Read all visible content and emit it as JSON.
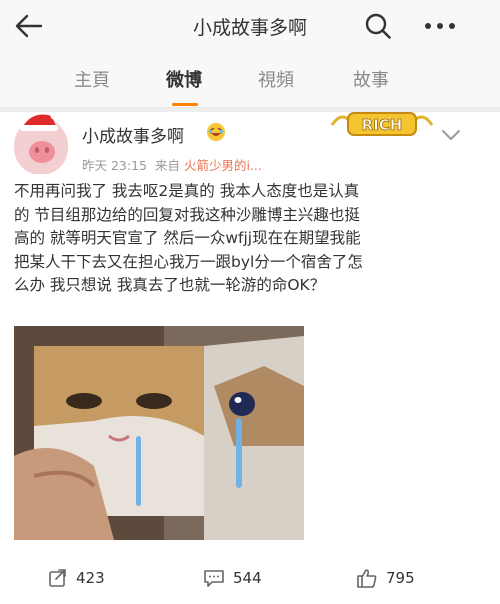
{
  "header": {
    "title": "小成故事多啊",
    "back_icon": "back-arrow-icon",
    "search_icon": "search-icon",
    "more_icon": "more-icon"
  },
  "tabs": [
    {
      "label": "主頁",
      "active": false
    },
    {
      "label": "微博",
      "active": true
    },
    {
      "label": "視頻",
      "active": false
    },
    {
      "label": "故事",
      "active": false
    }
  ],
  "post": {
    "author": "小成故事多啊",
    "time": "昨天 23:15",
    "source_prefix": "来自",
    "source": "火箭少男的i...",
    "badge_text": "RICH",
    "text_lines": [
      "不用再问我了 我去呕2是真的 我本人态度也是认真",
      "的 节目组那边给的回复对我这种沙雕博主兴趣也挺",
      "高的 就等明天官宣了 然后一众wfjj现在在期望我能",
      "把某人干下去又在担心我万一跟byl分一个宿舍了怎",
      "么办 我只想说 我真去了也就一轮游的命OK？"
    ]
  },
  "actions": {
    "repost_count": "423",
    "comment_count": "544",
    "like_count": "795"
  },
  "colors": {
    "accent": "#ff8200",
    "link": "#eb7350",
    "meta": "#999999"
  }
}
